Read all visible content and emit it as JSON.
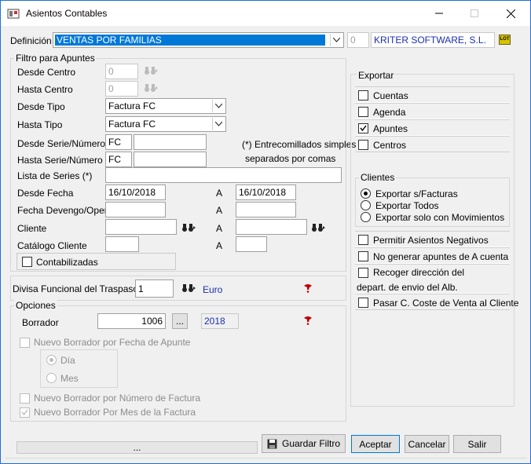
{
  "window": {
    "title": "Asientos Contables"
  },
  "header": {
    "definicion_label": "Definición",
    "definicion_value": "VENTAS POR FAMILIAS",
    "company_code": "0",
    "company_name": "KRITER SOFTWARE, S.L.",
    "lot_label": "LOT"
  },
  "filtro": {
    "title": "Filtro para Apuntes",
    "desde_centro_label": "Desde Centro",
    "desde_centro_value": "0",
    "hasta_centro_label": "Hasta Centro",
    "hasta_centro_value": "0",
    "desde_tipo_label": "Desde Tipo",
    "desde_tipo_value": "Factura FC",
    "hasta_tipo_label": "Hasta Tipo",
    "hasta_tipo_value": "Factura FC",
    "desde_serie_label": "Desde Serie/Número",
    "desde_serie_value": "FC",
    "hasta_serie_label": "Hasta Serie/Número",
    "hasta_serie_value": "FC",
    "note_line1": "(*) Entrecomillados simples",
    "note_line2": "separados por comas",
    "lista_series_label": "Lista de Series (*)",
    "desde_fecha_label": "Desde Fecha",
    "desde_fecha_value": "16/10/2018",
    "a_label": "A",
    "hasta_fecha_value": "16/10/2018",
    "fecha_devengo_label": "Fecha Devengo/Opera",
    "cliente_label": "Cliente",
    "catalogo_label": "Catálogo Cliente",
    "contabilizadas_label": "Contabilizadas"
  },
  "divisa": {
    "label": "Divisa Funcional del Traspaso",
    "value": "1",
    "name": "Euro"
  },
  "opciones": {
    "title": "Opciones",
    "borrador_label": "Borrador",
    "borrador_value": "1006",
    "ellipsis": "...",
    "year": "2018",
    "nuevo_fecha_label": "Nuevo Borrador por Fecha de Apunte",
    "dia_label": "Día",
    "mes_label": "Mes",
    "nuevo_numero_label": "Nuevo Borrador por Número de Factura",
    "nuevo_mes_label": "Nuevo Borrador Por Mes de la Factura"
  },
  "exportar": {
    "title": "Exportar",
    "items": [
      {
        "label": "Cuentas",
        "checked": false
      },
      {
        "label": "Agenda",
        "checked": false
      },
      {
        "label": "Apuntes",
        "checked": true
      },
      {
        "label": "Centros",
        "checked": false
      }
    ]
  },
  "clientes": {
    "title": "Clientes",
    "options": [
      {
        "label": "Exportar s/Facturas",
        "selected": true
      },
      {
        "label": "Exportar Todos",
        "selected": false
      },
      {
        "label": "Exportar solo con Movimientos",
        "selected": false
      }
    ]
  },
  "extras": {
    "permitir_negativos": "Permitir Asientos Negativos",
    "no_generar": "No generar apuntes de A cuenta",
    "recoger_line1": "Recoger dirección del",
    "recoger_line2": "depart. de envio del Alb.",
    "pasar_coste": "Pasar C. Coste de Venta al Cliente"
  },
  "footer": {
    "status": "...",
    "guardar": "Guardar Filtro",
    "aceptar": "Aceptar",
    "cancelar": "Cancelar",
    "salir": "Salir"
  },
  "colors": {
    "selection": "#0078d7",
    "blue_text": "#1c2fb0",
    "help_red": "#c00000"
  }
}
